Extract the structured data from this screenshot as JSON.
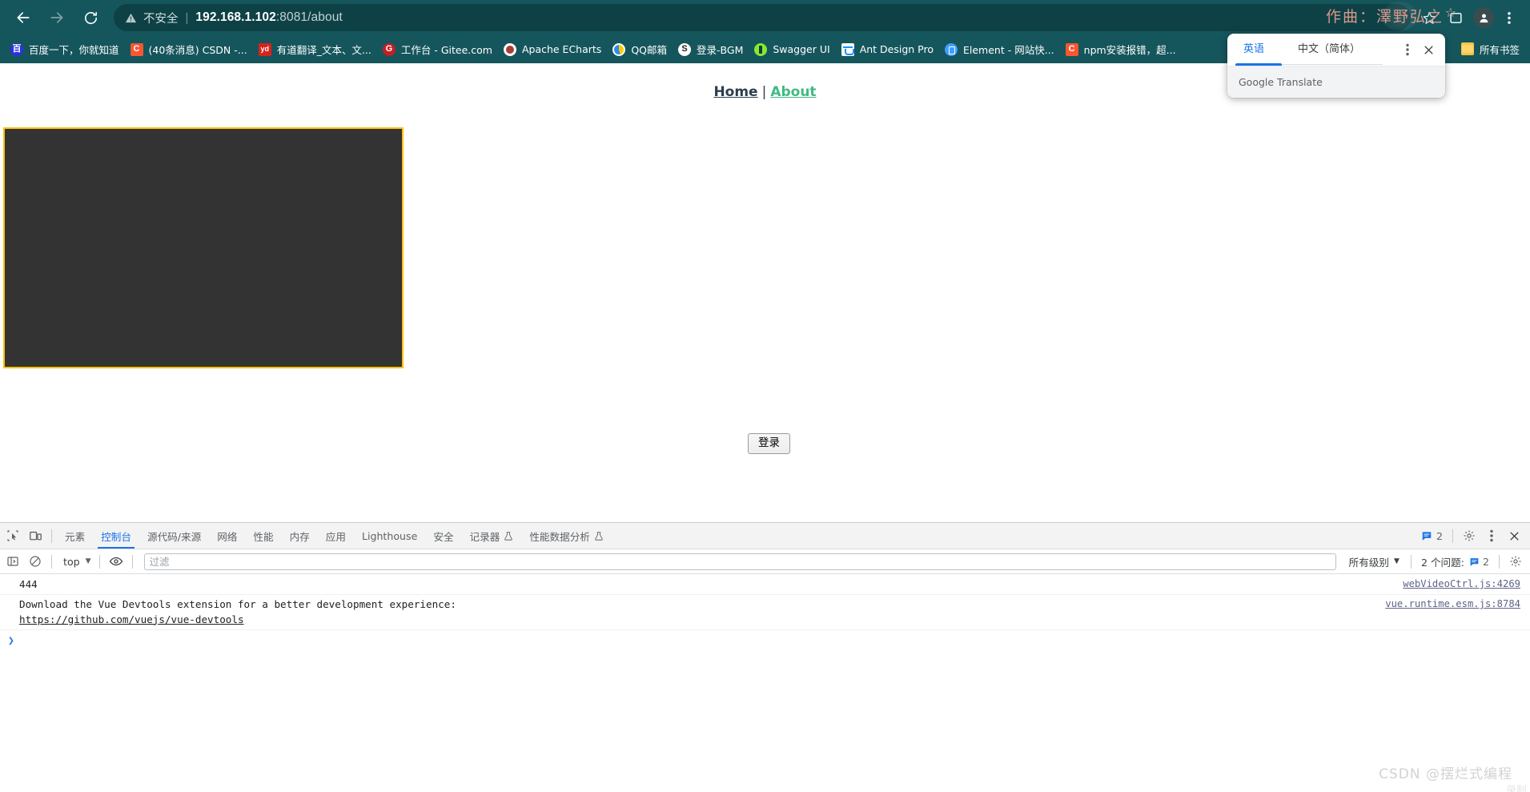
{
  "browser": {
    "back_icon": "arrow-left-icon",
    "forward_icon": "arrow-right-icon",
    "reload_icon": "reload-icon",
    "security_label": "不安全",
    "url_host": "192.168.1.102",
    "url_rest": ":8081/about",
    "bookmark_star_icon": "star-icon",
    "sidepanel_icon": "side-panel-icon",
    "profile_icon": "profile-avatar-icon",
    "menu_icon": "three-dot-menu-icon",
    "theme_color": "#15565c",
    "omnibox_color": "#0d4146"
  },
  "watermarks": {
    "artist": "作曲：澤野弘之",
    "footer": "CSDN @摆烂式编程",
    "footer_ghost": "录制"
  },
  "bookmarks": {
    "items": [
      {
        "label": "百度一下，你就知道",
        "icon": "baidu-favicon",
        "icon_class": "fi-baidu",
        "glyph": "百"
      },
      {
        "label": "(40条消息) CSDN -...",
        "icon": "csdn-favicon",
        "icon_class": "fi-csdn",
        "glyph": "C"
      },
      {
        "label": "有道翻译_文本、文...",
        "icon": "youdao-favicon",
        "icon_class": "fi-youdao",
        "glyph": "yd"
      },
      {
        "label": "工作台 - Gitee.com",
        "icon": "gitee-favicon",
        "icon_class": "fi-gitee",
        "glyph": "G"
      },
      {
        "label": "Apache ECharts",
        "icon": "echarts-favicon",
        "icon_class": "fi-echarts",
        "glyph": ""
      },
      {
        "label": "QQ邮箱",
        "icon": "qqmail-favicon",
        "icon_class": "fi-qq",
        "glyph": ""
      },
      {
        "label": "登录-BGM",
        "icon": "bgm-favicon",
        "icon_class": "fi-bgm",
        "glyph": ""
      },
      {
        "label": "Swagger UI",
        "icon": "swagger-favicon",
        "icon_class": "fi-swagger",
        "glyph": ""
      },
      {
        "label": "Ant Design Pro",
        "icon": "antdesign-favicon",
        "icon_class": "fi-antd",
        "glyph": ""
      },
      {
        "label": "Element - 网站快...",
        "icon": "element-favicon",
        "icon_class": "fi-element",
        "glyph": ""
      },
      {
        "label": "npm安装报错，超...",
        "icon": "csdn-favicon",
        "icon_class": "fi-csdn",
        "glyph": "C"
      }
    ],
    "all_bookmarks_label": "所有书签",
    "all_bookmarks_icon": "folder-icon"
  },
  "translate_popup": {
    "tab_source": "英语",
    "tab_target": "中文（简体）",
    "options_icon": "three-dot-menu-icon",
    "close_icon": "close-icon",
    "footer_text": "Google Translate",
    "accent": "#1a73e8"
  },
  "page": {
    "nav": {
      "home": "Home",
      "separator": "|",
      "about": "About",
      "home_color": "#2c3e50",
      "about_color": "#42b983"
    },
    "video_panel": {
      "name": "video-player-panel",
      "background": "#333333",
      "border_color": "#ffc107"
    },
    "login_button": "登录"
  },
  "devtools": {
    "inspect_icon": "inspect-element-icon",
    "device_icon": "device-toolbar-icon",
    "tabs": [
      {
        "label": "元素",
        "active": false,
        "flask": false
      },
      {
        "label": "控制台",
        "active": true,
        "flask": false
      },
      {
        "label": "源代码/来源",
        "active": false,
        "flask": false
      },
      {
        "label": "网络",
        "active": false,
        "flask": false
      },
      {
        "label": "性能",
        "active": false,
        "flask": false
      },
      {
        "label": "内存",
        "active": false,
        "flask": false
      },
      {
        "label": "应用",
        "active": false,
        "flask": false
      },
      {
        "label": "Lighthouse",
        "active": false,
        "flask": false
      },
      {
        "label": "安全",
        "active": false,
        "flask": false
      },
      {
        "label": "记录器",
        "active": false,
        "flask": true
      },
      {
        "label": "性能数据分析",
        "active": false,
        "flask": true
      }
    ],
    "toolbar_right": {
      "issue_count": "2",
      "issue_icon": "message-badge-icon",
      "settings_icon": "gear-icon",
      "more_icon": "three-dot-menu-icon",
      "close_icon": "close-icon"
    },
    "console_toolbar": {
      "sidebar_icon": "console-sidebar-icon",
      "clear_icon": "clear-console-icon",
      "context": "top",
      "eye_icon": "live-expression-eye-icon",
      "filter_placeholder": "过滤",
      "filter_value": "",
      "level": "所有级别",
      "issues_label": "2 个问题:",
      "issues_count": "2",
      "settings_icon": "gear-icon"
    },
    "console_messages": [
      {
        "text": "444",
        "source": "webVideoCtrl.js:4269",
        "link": "",
        "link_text": ""
      },
      {
        "text": "Download the Vue Devtools extension for a better development experience:",
        "source": "vue.runtime.esm.js:8784",
        "link": "https://github.com/vuejs/vue-devtools",
        "link_text": "https://github.com/vuejs/vue-devtools"
      }
    ],
    "prompt_chevron": "❯"
  }
}
